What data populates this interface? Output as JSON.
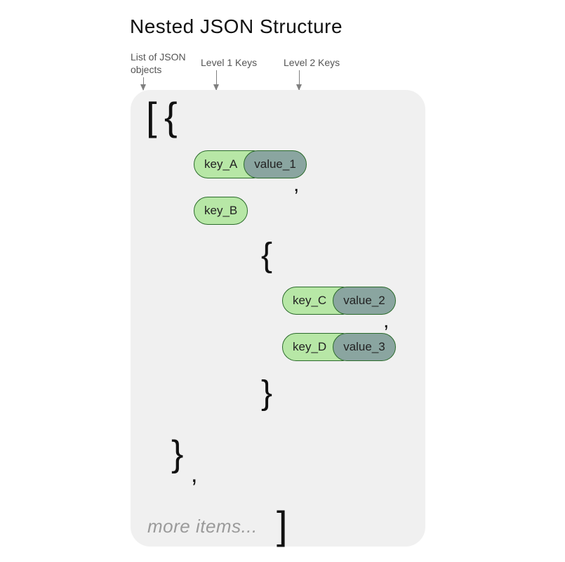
{
  "title": "Nested JSON Structure",
  "annotations": {
    "list": "List of JSON\nobjects",
    "level1": "Level 1 Keys",
    "level2": "Level 2 Keys"
  },
  "symbols": {
    "open_bracket": "[",
    "open_brace_outer": "{",
    "open_brace_inner": "{",
    "close_brace_inner": "}",
    "close_brace_outer": "}",
    "close_bracket": "]",
    "comma_after_brace": ",",
    "comma1": ",",
    "comma2": ","
  },
  "pairs": {
    "a": {
      "key": "key_A",
      "value": "value_1"
    },
    "b": {
      "key": "key_B"
    },
    "c": {
      "key": "key_C",
      "value": "value_2"
    },
    "d": {
      "key": "key_D",
      "value": "value_3"
    }
  },
  "more": "more items..."
}
